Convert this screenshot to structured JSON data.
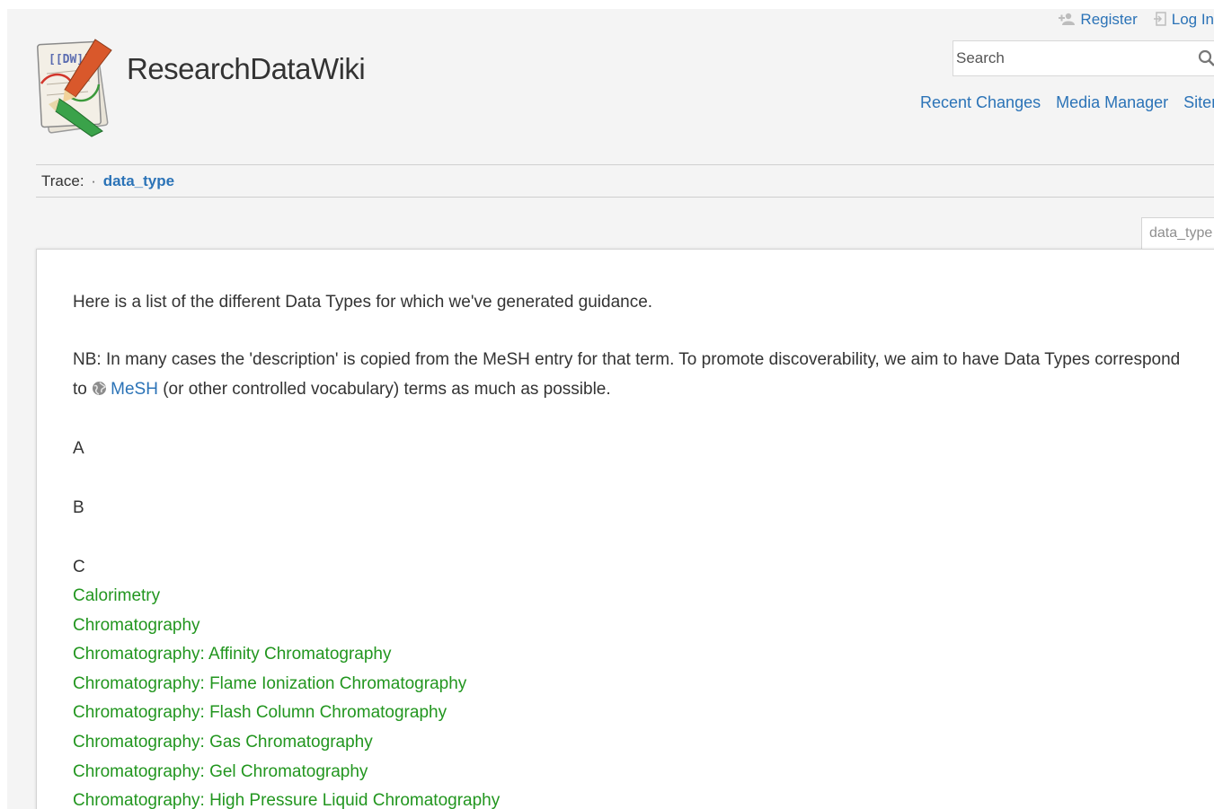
{
  "header": {
    "site_title": "ResearchDataWiki",
    "logo_icon": "dokuwiki-logo-icon",
    "logo_text": "[[DW]]",
    "user_tools": [
      {
        "label": "Register",
        "icon": "register-icon"
      },
      {
        "label": "Log In",
        "icon": "login-icon"
      }
    ],
    "search": {
      "placeholder": "Search",
      "icon": "search-icon"
    },
    "site_tools": [
      "Recent Changes",
      "Media Manager",
      "Sitemap"
    ]
  },
  "breadcrumbs": {
    "label": "Trace:",
    "items": [
      "data_type"
    ]
  },
  "page_tab": "data_type",
  "content": {
    "intro": "Here is a list of the different Data Types for which we've generated guidance.",
    "nb_text": "NB: In many cases the 'description' is copied from the MeSH entry for that term. To promote discoverability, we aim to have Data Types correspond",
    "nb_to": "to",
    "mesh_link": "MeSH",
    "nb_rest": "(or other controlled vocabulary) terms as much as possible.",
    "letters": [
      "A",
      "B",
      "C"
    ],
    "c_items": [
      "Calorimetry",
      "Chromatography",
      "Chromatography: Affinity Chromatography",
      "Chromatography: Flame Ionization Chromatography",
      "Chromatography: Flash Column Chromatography",
      "Chromatography: Gas Chromatography",
      "Chromatography: Gel Chromatography",
      "Chromatography: High Pressure Liquid Chromatography"
    ]
  },
  "colors": {
    "link": "#2b73b7",
    "list_link": "#22961f",
    "text": "#333333",
    "background": "#f4f4f4"
  }
}
